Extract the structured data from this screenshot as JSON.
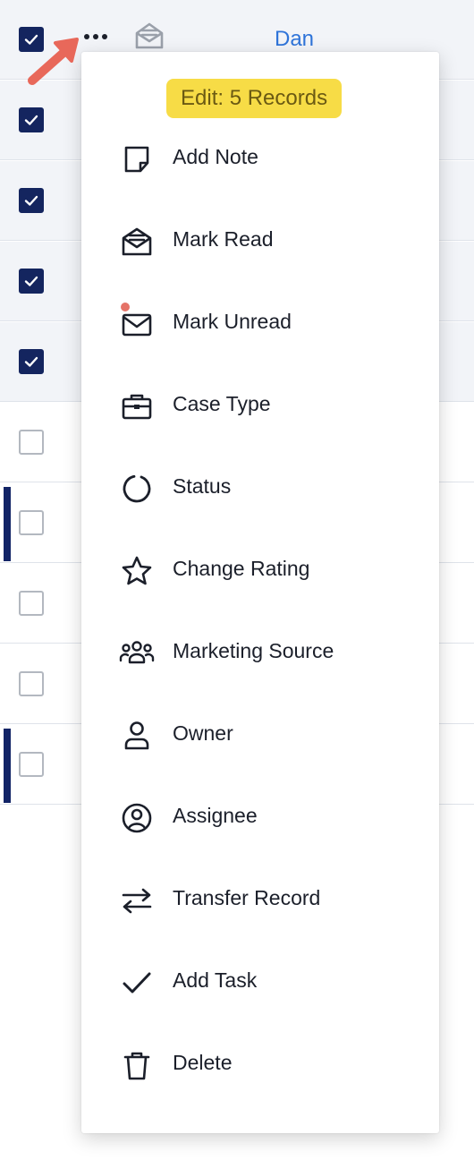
{
  "header": {
    "name_text": "Dan"
  },
  "rows": [
    {
      "checked": true,
      "accent": false
    },
    {
      "checked": true,
      "accent": false
    },
    {
      "checked": true,
      "accent": false
    },
    {
      "checked": true,
      "accent": false
    },
    {
      "checked": true,
      "accent": false
    },
    {
      "checked": false,
      "accent": false
    },
    {
      "checked": false,
      "accent": true
    },
    {
      "checked": false,
      "accent": false
    },
    {
      "checked": false,
      "accent": false
    },
    {
      "checked": false,
      "accent": true
    }
  ],
  "menu": {
    "badge": "Edit: 5 Records",
    "items": [
      {
        "label": "Add Note",
        "icon": "note-icon"
      },
      {
        "label": "Mark Read",
        "icon": "mail-open-icon"
      },
      {
        "label": "Mark Unread",
        "icon": "mail-icon"
      },
      {
        "label": "Case Type",
        "icon": "briefcase-icon"
      },
      {
        "label": "Status",
        "icon": "status-circle-icon"
      },
      {
        "label": "Change Rating",
        "icon": "star-icon"
      },
      {
        "label": "Marketing Source",
        "icon": "users-icon"
      },
      {
        "label": "Owner",
        "icon": "user-icon"
      },
      {
        "label": "Assignee",
        "icon": "user-circle-icon"
      },
      {
        "label": "Transfer Record",
        "icon": "transfer-arrows-icon"
      },
      {
        "label": "Add Task",
        "icon": "check-icon"
      },
      {
        "label": "Delete",
        "icon": "trash-icon"
      }
    ]
  },
  "colors": {
    "checkbox_checked": "#14255f",
    "accent_bar": "#122466",
    "badge_bg": "#f7dc46",
    "link_blue": "#2f74d9",
    "pointer_arrow": "#e8685a",
    "unread_dot": "#e57368"
  }
}
